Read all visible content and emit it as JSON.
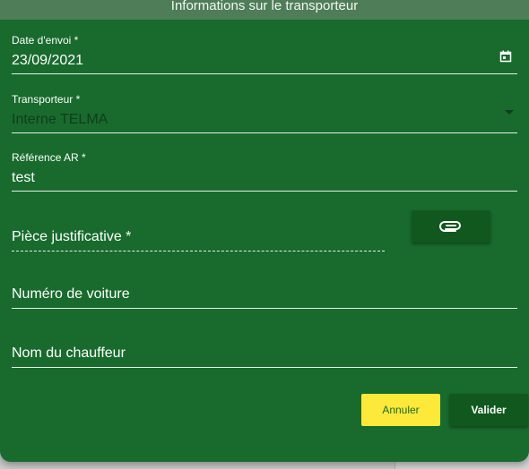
{
  "dialog": {
    "title": "Informations sur le transporteur"
  },
  "form": {
    "date_envoi": {
      "label": "Date d'envoi *",
      "value": "23/09/2021",
      "icon": "calendar-icon"
    },
    "transporteur": {
      "label": "Transporteur *",
      "value": "Interne TELMA",
      "icon": "caret-down-icon"
    },
    "reference_ar": {
      "label": "Référence AR *",
      "value": "test"
    },
    "piece_justificative": {
      "label": "Pièce justificative *",
      "attach_icon": "paperclip-icon"
    },
    "numero_voiture": {
      "placeholder": "Numéro de voiture"
    },
    "nom_chauffeur": {
      "placeholder": "Nom du chauffeur"
    }
  },
  "actions": {
    "cancel_label": "Annuler",
    "submit_label": "Valider"
  },
  "colors": {
    "dialog_bg": "#186b2d",
    "header_bg": "#4e7d57",
    "primary_button": "#11581f",
    "cancel_button": "#fde93a"
  }
}
